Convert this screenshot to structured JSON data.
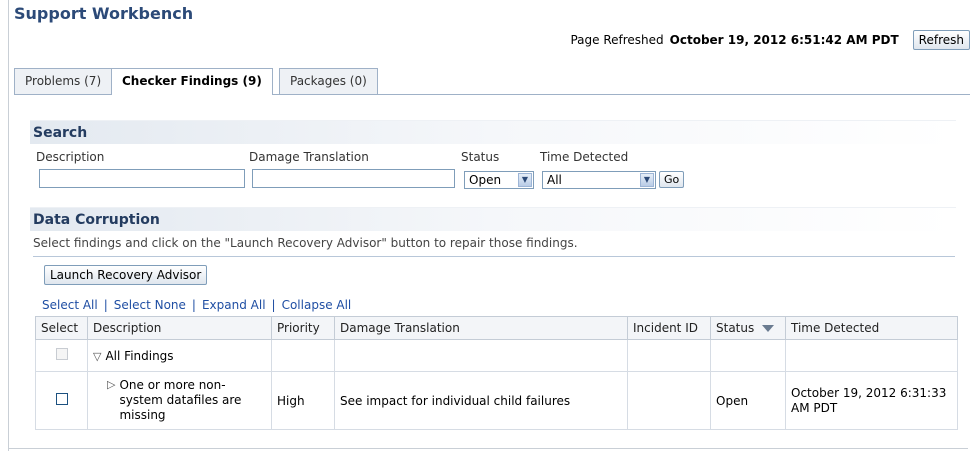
{
  "app": {
    "title": "Support Workbench"
  },
  "header": {
    "refreshed_label": "Page Refreshed",
    "refreshed_time": "October 19, 2012 6:51:42 AM PDT",
    "refresh_button": "Refresh"
  },
  "tabs": [
    {
      "label": "Problems (7)",
      "active": false
    },
    {
      "label": "Checker Findings (9)",
      "active": true
    },
    {
      "label": "Packages (0)",
      "active": false
    }
  ],
  "search": {
    "heading": "Search",
    "description_label": "Description",
    "description_value": "",
    "damage_label": "Damage Translation",
    "damage_value": "",
    "status_label": "Status",
    "status_value": "Open",
    "time_label": "Time Detected",
    "time_value": "All",
    "go_button": "Go"
  },
  "data_corruption": {
    "heading": "Data Corruption",
    "instruction": "Select findings and click on the \"Launch Recovery Advisor\" button to repair those findings.",
    "launch_button": "Launch Recovery Advisor",
    "links": [
      "Select All",
      "Select None",
      "Expand All",
      "Collapse All"
    ],
    "columns": [
      "Select",
      "Description",
      "Priority",
      "Damage Translation",
      "Incident ID",
      "Status",
      "Time Detected"
    ],
    "rows": [
      {
        "description": "All Findings",
        "priority": "",
        "damage": "",
        "incident": "",
        "status": "",
        "time": ""
      },
      {
        "description": "One or more non-system datafiles are missing",
        "priority": "High",
        "damage": "See impact for individual child failures",
        "incident": "",
        "status": "Open",
        "time": "October 19, 2012 6:31:33 AM PDT"
      }
    ]
  },
  "colors": {
    "title": "#2c4a78",
    "link": "#1f4ea3",
    "section_bg": "#e3e9f0"
  },
  "icons": {
    "sort": "sort-descending-icon",
    "expand": "triangle-down-icon",
    "collapse": "triangle-right-icon"
  }
}
